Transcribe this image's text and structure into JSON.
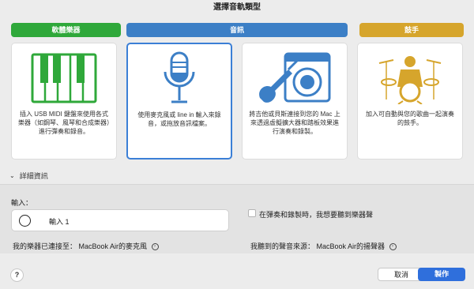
{
  "window": {
    "title": "選擇音軌類型"
  },
  "categories": [
    {
      "label": "軟體樂器",
      "color": "#2fa83a"
    },
    {
      "label": "音訊",
      "color": "#3c7fc6"
    },
    {
      "label": "鼓手",
      "color": "#d6a52c"
    }
  ],
  "cards": [
    {
      "description": "插入 USB MIDI 鍵盤來使用各式樂器（如鋼琴、風琴和合成樂器）進行彈奏和錄音。"
    },
    {
      "description": "使用麥克風或 line in 輸入來錄音，或拖放音訊檔案。"
    },
    {
      "description": "將吉他或貝斯連接到您的 Mac 上來透過虛擬擴大器和踏板效果進行演奏和錄製。"
    },
    {
      "description": "加入可自動與您的歌曲一起演奏的鼓手。"
    }
  ],
  "details": {
    "label": "詳細資訊"
  },
  "input": {
    "label": "輸入：",
    "value": "輸入 1"
  },
  "monitor": {
    "label": "在彈奏和錄製時，我想要聽到樂器聲"
  },
  "connection": {
    "instrument_label": "我的樂器已連接至： MacBook Air的麥克風",
    "output_label": "我聽到的聲音來源： MacBook Air的揚聲器"
  },
  "buttons": {
    "help": "?",
    "cancel": "取消",
    "create": "製作"
  },
  "colors": {
    "accent": "#2f6fdc",
    "selected_border": "#3b7fd6"
  }
}
